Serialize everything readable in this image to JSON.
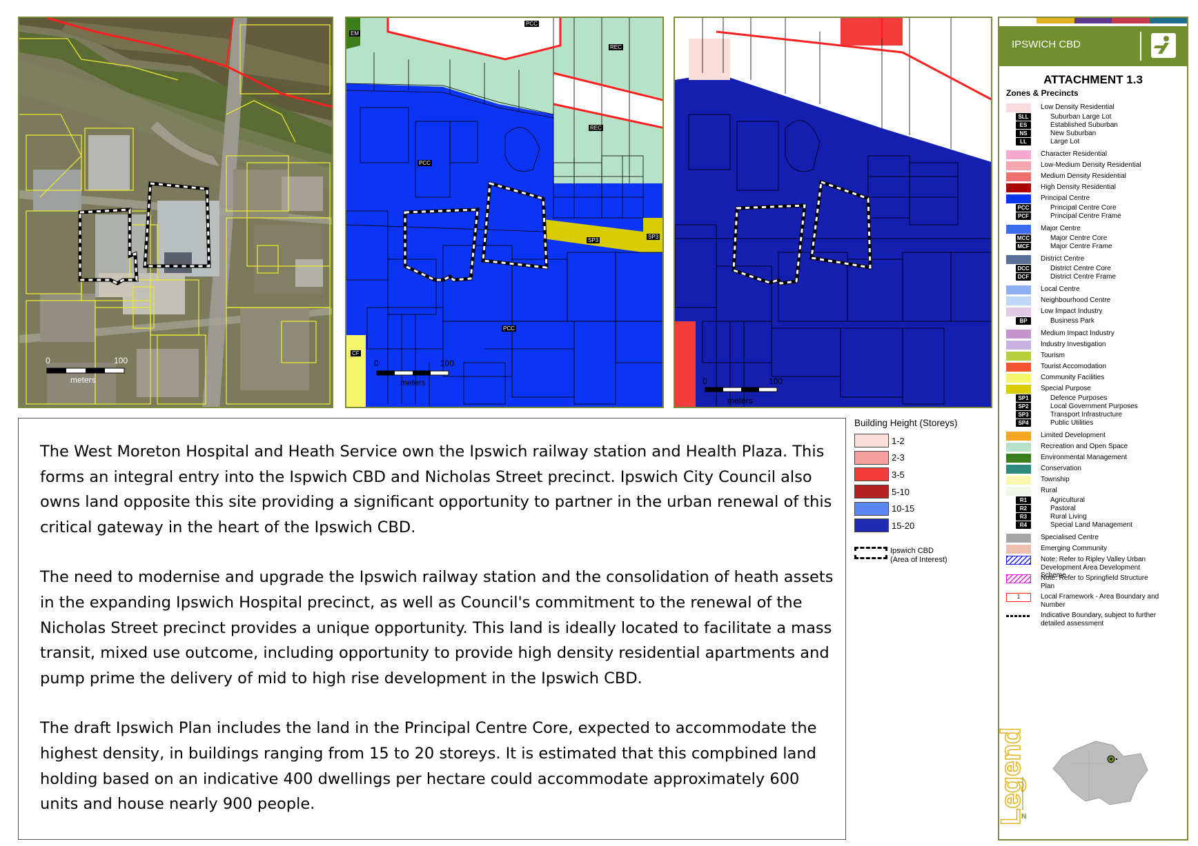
{
  "maps": {
    "aerial": {
      "scale": {
        "zero": "0",
        "max": "100",
        "unit": "meters"
      }
    },
    "zoning": {
      "labels": [
        "EM",
        "PCC",
        "REC",
        "REC",
        "PCC",
        "SP3",
        "SP3",
        "PCC",
        "CF"
      ],
      "scale": {
        "zero": "0",
        "max": "100",
        "unit": "meters"
      }
    },
    "height": {
      "scale": {
        "zero": "0",
        "max": "100",
        "unit": "meters"
      }
    }
  },
  "text": {
    "paragraphs": [
      "The West Moreton Hospital and Heath Service own the Ipswich railway station and Health Plaza. This forms an integral entry into the Ispwich CBD and Nicholas Street precinct. Ipswich City Council also owns land opposite this site providing a significant opportunity to partner in the urban renewal of this critical gateway in the heart of the Ipswich CBD.",
      "The need to modernise and upgrade the Ipswich railway station and the consolidation of heath assets in the expanding Ipswich Hospital precinct, as well as Council's commitment to the renewal of the Nicholas Street precinct provides a unique opportunity. This land is ideally located to facilitate a mass transit, mixed use outcome, including opportunity to provide high density residential apartments and pump prime the delivery of mid to high rise development in the Ipswich CBD.",
      "The draft Ipswich Plan includes the land in the Principal Centre Core, expected to accommodate the highest density, in buildings ranging from 15 to 20 storeys. It is estimated that this compbined land holding based on an indicative 400 dwellings per hectare could accommodate approximately 600 units and house nearly 900 people."
    ]
  },
  "building_height": {
    "title": "Building Height (Storeys)",
    "items": [
      {
        "label": "1-2",
        "color": "#fbded8"
      },
      {
        "label": "2-3",
        "color": "#f8a0a0"
      },
      {
        "label": "3-5",
        "color": "#f23c3c"
      },
      {
        "label": "5-10",
        "color": "#b41f1f"
      },
      {
        "label": "10-15",
        "color": "#5c86f4"
      },
      {
        "label": "15-20",
        "color": "#1e2bb0"
      }
    ],
    "cbd_line1": "Ipswich CBD",
    "cbd_line2": "(Area of Interest)"
  },
  "legend": {
    "header": "IPSWICH CBD",
    "attachment": "ATTACHMENT 1.3",
    "subtitle": "Zones & Precincts",
    "top_bar_colors": [
      "#ffffff",
      "#e2b21c",
      "#5b3a8c",
      "#c73a4d",
      "#1e6e8c"
    ],
    "items": [
      {
        "type": "swatch",
        "color": "#fadbe0",
        "label": "Low Density Residential"
      },
      {
        "type": "tag",
        "tag": "SLL",
        "label": "Suburban Large Lot"
      },
      {
        "type": "tag",
        "tag": "ES",
        "label": "Established Suburban"
      },
      {
        "type": "tag",
        "tag": "NS",
        "label": "New Suburban"
      },
      {
        "type": "tag",
        "tag": "LL",
        "label": "Large Lot"
      },
      {
        "type": "swatch",
        "color": "#f7a8cf",
        "label": "Character Residential"
      },
      {
        "type": "swatch",
        "color": "#f6a6ae",
        "label": "Low-Medium Density Residential"
      },
      {
        "type": "swatch",
        "color": "#f07070",
        "label": "Medium Density Residential"
      },
      {
        "type": "swatch",
        "color": "#a80000",
        "label": "High Density Residential"
      },
      {
        "type": "swatch",
        "color": "#0a36f0",
        "label": "Principal Centre"
      },
      {
        "type": "tag",
        "tag": "PCC",
        "label": "Principal Centre Core"
      },
      {
        "type": "tag",
        "tag": "PCF",
        "label": "Principal Centre Frame"
      },
      {
        "type": "swatch",
        "color": "#3c6cee",
        "label": "Major Centre"
      },
      {
        "type": "tag",
        "tag": "MCC",
        "label": "Major Centre Core"
      },
      {
        "type": "tag",
        "tag": "MCF",
        "label": "Major Centre Frame"
      },
      {
        "type": "swatch",
        "color": "#5a6f97",
        "label": "District Centre"
      },
      {
        "type": "tag",
        "tag": "DCC",
        "label": "District Centre Core"
      },
      {
        "type": "tag",
        "tag": "DCF",
        "label": "District Centre Frame"
      },
      {
        "type": "swatch",
        "color": "#8db0f5",
        "label": "Local Centre"
      },
      {
        "type": "swatch",
        "color": "#bfd8f7",
        "label": "Neighbourhood Centre"
      },
      {
        "type": "swatch",
        "color": "#e2c9e6",
        "label": "Low Impact Industry"
      },
      {
        "type": "tag",
        "tag": "BP",
        "label": "Business Park"
      },
      {
        "type": "swatch",
        "color": "#c495ca",
        "label": "Medium Impact Industry"
      },
      {
        "type": "swatch",
        "color": "#c9b2e0",
        "label": "Industry Investigation"
      },
      {
        "type": "swatch",
        "color": "#b7cf3a",
        "label": "Tourism"
      },
      {
        "type": "swatch",
        "color": "#f2552f",
        "label": "Tourist Accomodation"
      },
      {
        "type": "swatch",
        "color": "#f7f56a",
        "label": "Community Facilities"
      },
      {
        "type": "swatch",
        "color": "#d8cd00",
        "label": "Special Purpose"
      },
      {
        "type": "tag",
        "tag": "SP1",
        "label": "Defence Purposes"
      },
      {
        "type": "tag",
        "tag": "SP2",
        "label": "Local Government Purposes"
      },
      {
        "type": "tag",
        "tag": "SP3",
        "label": "Transport Infrastructure"
      },
      {
        "type": "tag",
        "tag": "SP4",
        "label": "Public Utilities"
      },
      {
        "type": "swatch",
        "color": "#f6a623",
        "label": "Limited Development"
      },
      {
        "type": "swatch",
        "color": "#b5e2c8",
        "label": "Recreation and Open Space"
      },
      {
        "type": "swatch",
        "color": "#3c7d1c",
        "label": "Environmental Management"
      },
      {
        "type": "swatch",
        "color": "#2e8a7c",
        "label": "Conservation"
      },
      {
        "type": "swatch",
        "color": "#fbf7b0",
        "label": "Township"
      },
      {
        "type": "swatch",
        "color": "#f0f7e6",
        "label": "Rural"
      },
      {
        "type": "tag",
        "tag": "R1",
        "label": "Agricultural"
      },
      {
        "type": "tag",
        "tag": "R2",
        "label": "Pastoral"
      },
      {
        "type": "tag",
        "tag": "R3",
        "label": "Rural Living"
      },
      {
        "type": "tag",
        "tag": "R4",
        "label": "Special Land Management"
      },
      {
        "type": "swatch",
        "color": "#a6a6a6",
        "label": "Specialised Centre"
      },
      {
        "type": "swatch",
        "color": "#edbfae",
        "label": "Emerging Community"
      },
      {
        "type": "hatch",
        "color": "#1a1aff",
        "label": "Note: Refer to Ripley Valley Urban Development Area Development Scheme"
      },
      {
        "type": "hatch",
        "color": "#e020e0",
        "label": "Note: Refer to Springfield Structure Plan"
      },
      {
        "type": "framework",
        "tag": "1",
        "label": "Local Framework - Area Boundary and Number"
      },
      {
        "type": "dashed",
        "label": "Indicative Boundary, subject to further detailed assessment"
      }
    ],
    "legend_word": "Legend",
    "north": "N"
  }
}
